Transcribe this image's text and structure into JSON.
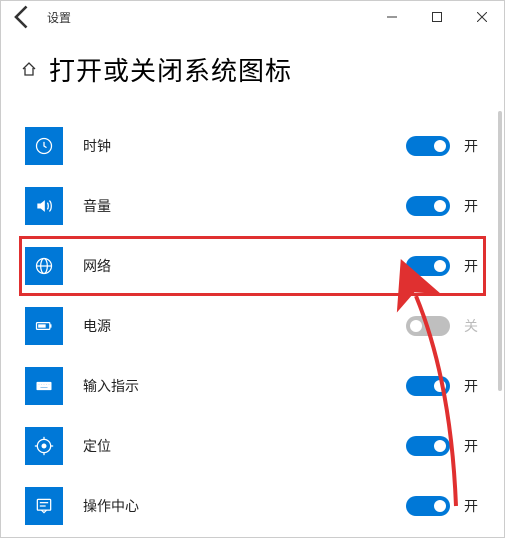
{
  "window": {
    "title": "设置"
  },
  "page": {
    "heading": "打开或关闭系统图标"
  },
  "items": [
    {
      "label": "时钟",
      "enabled": true,
      "on_text": "开",
      "off_text": "关",
      "icon": "clock",
      "highlight": false
    },
    {
      "label": "音量",
      "enabled": true,
      "on_text": "开",
      "off_text": "关",
      "icon": "volume",
      "highlight": false
    },
    {
      "label": "网络",
      "enabled": true,
      "on_text": "开",
      "off_text": "关",
      "icon": "network",
      "highlight": true
    },
    {
      "label": "电源",
      "enabled": false,
      "on_text": "开",
      "off_text": "关",
      "icon": "power",
      "highlight": false
    },
    {
      "label": "输入指示",
      "enabled": true,
      "on_text": "开",
      "off_text": "关",
      "icon": "input",
      "highlight": false
    },
    {
      "label": "定位",
      "enabled": true,
      "on_text": "开",
      "off_text": "关",
      "icon": "location",
      "highlight": false
    },
    {
      "label": "操作中心",
      "enabled": true,
      "on_text": "开",
      "off_text": "关",
      "icon": "action",
      "highlight": false
    }
  ]
}
